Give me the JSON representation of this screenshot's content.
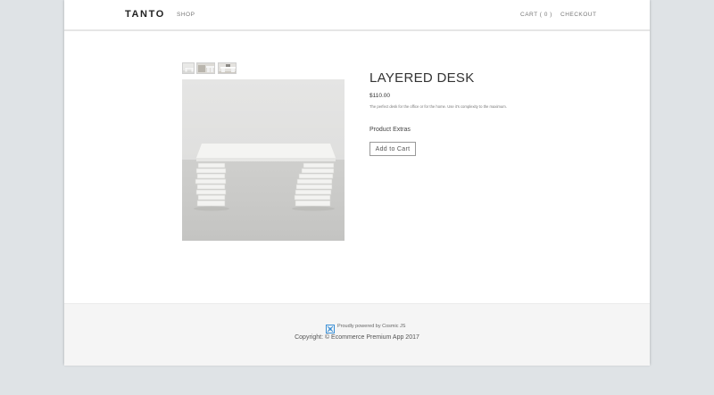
{
  "header": {
    "logo": "TANTO",
    "nav": {
      "shop": "SHOP",
      "cart": "CART ( 0 )",
      "checkout": "CHECKOUT"
    }
  },
  "product": {
    "title": "LAYERED DESK",
    "price": "$110.00",
    "description": "The perfect desk for the office or for the home. Use it's complexity to the maximum.",
    "extras_label": "Product Extras",
    "add_to_cart_label": "Add to Cart",
    "thumbnail_count": 3
  },
  "footer": {
    "powered_by": "Proudly powered by Cosmic JS",
    "copyright": "Copyright: © Ecommerce Premium App 2017"
  },
  "colors": {
    "outer_background": "#dfe3e6",
    "page_background": "#ffffff",
    "footer_background": "#f5f5f5",
    "text_dark": "#333333",
    "text_muted": "#777777",
    "cosmic_icon": "#3a8fd6"
  }
}
